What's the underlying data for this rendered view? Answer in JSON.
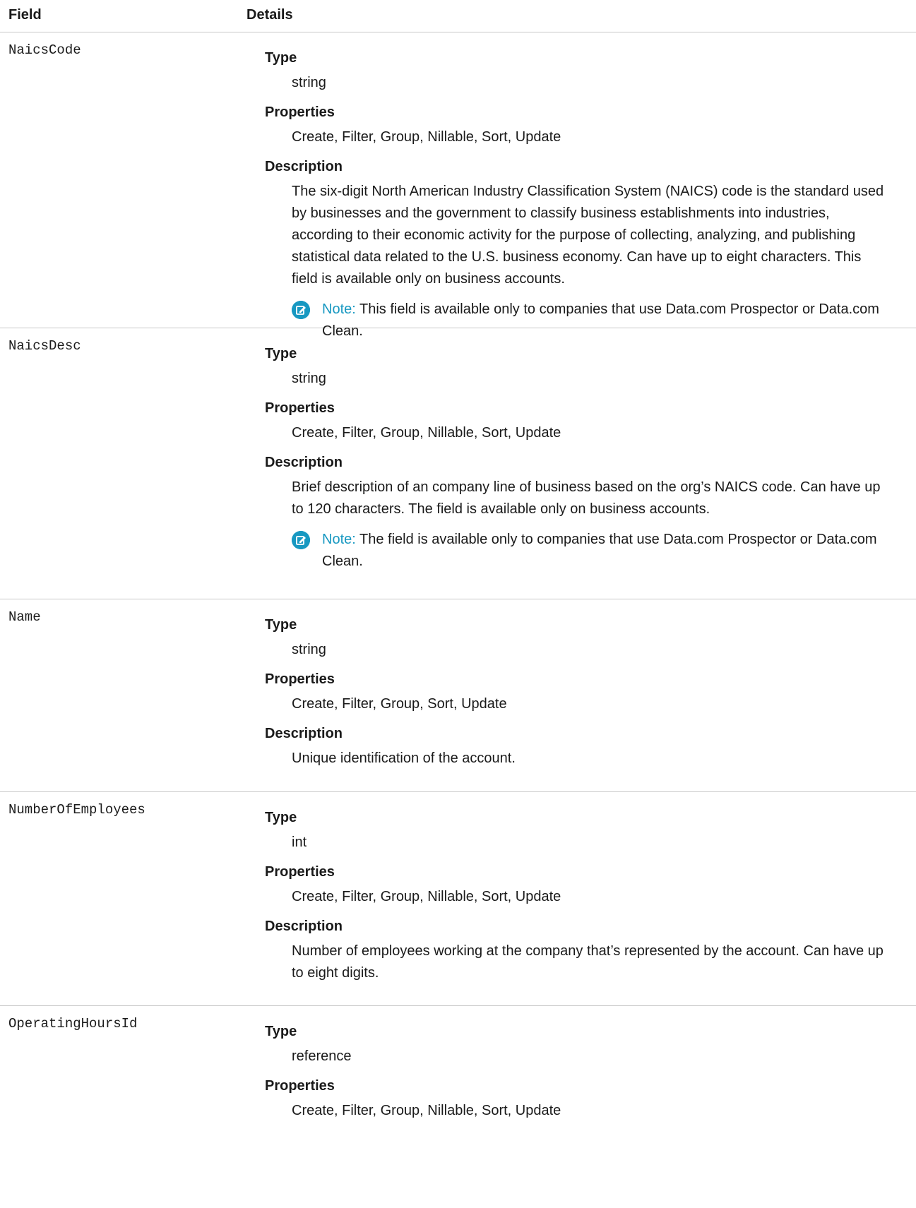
{
  "header": {
    "field": "Field",
    "details": "Details"
  },
  "rows": [
    {
      "field_name": "NaicsCode",
      "type_label": "Type",
      "type_value": "string",
      "properties_label": "Properties",
      "properties_value": "Create, Filter, Group, Nillable, Sort, Update",
      "description_label": "Description",
      "description_value": "The six-digit North American Industry Classification System (NAICS) code is the standard used by businesses and the government to classify business establishments into industries, according to their economic activity for the purpose of collecting, analyzing, and publishing statistical data related to the U.S. business economy. Can have up to eight characters. This field is available only on business accounts.",
      "note_label": "Note:",
      "note_text": "This field is available only to companies that use Data.com Prospector or Data.com Clean."
    },
    {
      "field_name": "NaicsDesc",
      "type_label": "Type",
      "type_value": "string",
      "properties_label": "Properties",
      "properties_value": "Create, Filter, Group, Nillable, Sort, Update",
      "description_label": "Description",
      "description_value": "Brief description of an company line of business based on the org’s NAICS code. Can have up to 120 characters. The field is available only on business accounts.",
      "note_label": "Note:",
      "note_text": "The field is available only to companies that use Data.com Prospector or Data.com Clean."
    },
    {
      "field_name": "Name",
      "type_label": "Type",
      "type_value": "string",
      "properties_label": "Properties",
      "properties_value": "Create, Filter, Group, Sort, Update",
      "description_label": "Description",
      "description_value": "Unique identification of the account."
    },
    {
      "field_name": "NumberOfEmployees",
      "type_label": "Type",
      "type_value": "int",
      "properties_label": "Properties",
      "properties_value": "Create, Filter, Group, Nillable, Sort, Update",
      "description_label": "Description",
      "description_value": "Number of employees working at the company that’s represented by the account. Can have up to eight digits."
    },
    {
      "field_name": "OperatingHoursId",
      "type_label": "Type",
      "type_value": "reference",
      "properties_label": "Properties",
      "properties_value": "Create, Filter, Group, Nillable, Sort, Update"
    }
  ],
  "colors": {
    "note_accent": "#1798c1",
    "divider": "#c8c8c8"
  },
  "icons": {
    "note": "note-edit-icon"
  }
}
